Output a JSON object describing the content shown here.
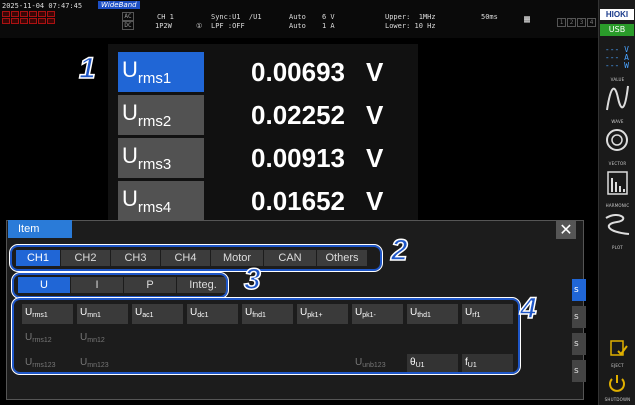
{
  "status": {
    "datetime": "2025-11-04 07:47:45",
    "wideband": "WideBand",
    "channel": "CH 1",
    "wiring": "1P2W",
    "circle_one": "①",
    "sync": "Sync:U1  /U1",
    "lpf": "LPF :OFF",
    "range_v_mode": "Auto",
    "range_v": "6 V",
    "range_a_mode": "Auto",
    "range_a": "1 A",
    "upper": "Upper:  1MHz",
    "lower": "Lower: 10 Hz",
    "rate": "50ms",
    "numbers": [
      "1",
      "2",
      "3",
      "4"
    ],
    "ac": "AC",
    "dc": "DC"
  },
  "side": {
    "brand": "HIOKI",
    "usb": "USB",
    "buttons": [
      "VALUE",
      "WAVE",
      "VECTOR",
      "HARMONIC",
      "PLOT",
      "EJECT",
      "SHUTDOWN"
    ]
  },
  "measurements": [
    {
      "name": "U",
      "sub": "rms1",
      "value": "0.00693",
      "unit": "V",
      "active": true
    },
    {
      "name": "U",
      "sub": "rms2",
      "value": "0.02252",
      "unit": "V",
      "active": false
    },
    {
      "name": "U",
      "sub": "rms3",
      "value": "0.00913",
      "unit": "V",
      "active": false
    },
    {
      "name": "U",
      "sub": "rms4",
      "value": "0.01652",
      "unit": "V",
      "active": false
    }
  ],
  "callouts": [
    "1",
    "2",
    "3",
    "4"
  ],
  "dialog": {
    "title": "Item",
    "close": "✕",
    "channel_tabs": [
      "CH1",
      "CH2",
      "CH3",
      "CH4",
      "Motor",
      "CAN",
      "Others"
    ],
    "type_tabs": [
      "U",
      "I",
      "P",
      "Integ."
    ],
    "side_s": [
      "s",
      "s",
      "s",
      "s"
    ],
    "params_row1": [
      {
        "name": "U",
        "sub": "rms1"
      },
      {
        "name": "U",
        "sub": "mn1"
      },
      {
        "name": "U",
        "sub": "ac1"
      },
      {
        "name": "U",
        "sub": "dc1"
      },
      {
        "name": "U",
        "sub": "fnd1"
      },
      {
        "name": "U",
        "sub": "pk1+"
      },
      {
        "name": "U",
        "sub": "pk1-"
      },
      {
        "name": "U",
        "sub": "thd1"
      },
      {
        "name": "U",
        "sub": "rf1"
      }
    ],
    "params_row2": [
      {
        "name": "U",
        "sub": "rms12"
      },
      {
        "name": "U",
        "sub": "mn12"
      }
    ],
    "params_row3": [
      {
        "name": "U",
        "sub": "rms123"
      },
      {
        "name": "U",
        "sub": "mn123"
      },
      {
        "name": "U",
        "sub": "unb123"
      },
      {
        "name": "θ",
        "sub": "U1"
      },
      {
        "name": "f",
        "sub": "U1"
      }
    ]
  }
}
